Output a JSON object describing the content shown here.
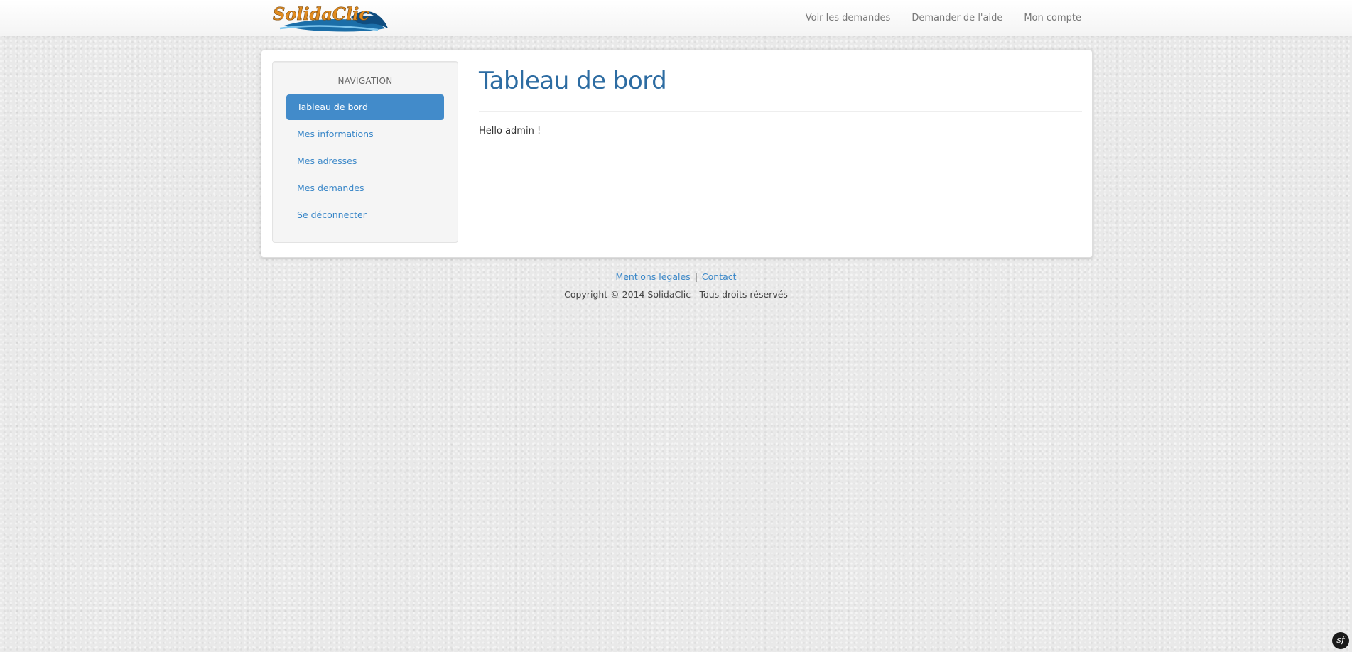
{
  "brand": {
    "logo_text": "SolidaClic"
  },
  "navbar": {
    "links": [
      {
        "label": "Voir les demandes"
      },
      {
        "label": "Demander de l'aide"
      },
      {
        "label": "Mon compte"
      }
    ]
  },
  "sidebar": {
    "header": "NAVIGATION",
    "items": [
      {
        "label": "Tableau de bord",
        "active": true
      },
      {
        "label": "Mes informations",
        "active": false
      },
      {
        "label": "Mes adresses",
        "active": false
      },
      {
        "label": "Mes demandes",
        "active": false
      },
      {
        "label": "Se déconnecter",
        "active": false
      }
    ]
  },
  "main": {
    "title": "Tableau de bord",
    "greeting": "Hello admin !"
  },
  "footer": {
    "links": [
      {
        "label": "Mentions légales"
      },
      {
        "label": "Contact"
      }
    ],
    "separator": "|",
    "copyright": "Copyright © 2014 SolidaClic - Tous droits réservés"
  },
  "debug_toolbar": {
    "icon": "symfony-icon",
    "glyph": "sf"
  },
  "colors": {
    "accent": "#428bca",
    "link": "#3a87c8",
    "title": "#2d6ca2"
  }
}
